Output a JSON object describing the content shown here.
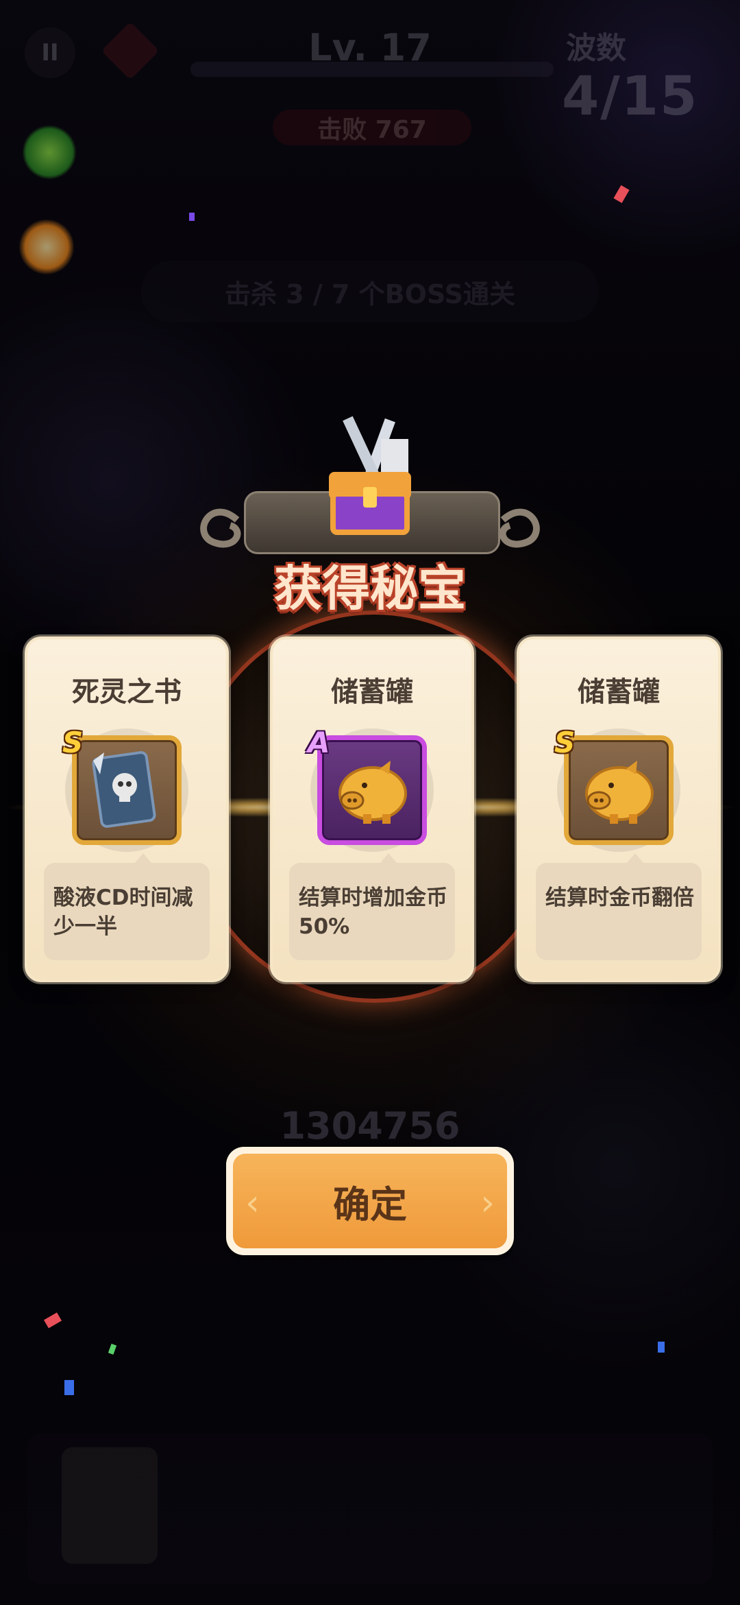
{
  "hud": {
    "pause_label": "II",
    "level": "Lv. 17",
    "wave_label": "波数",
    "wave_value": "4/15",
    "defeat_text": "击败 767",
    "objective_text": "击杀 3 / 7 个BOSS通关",
    "score": "1304756"
  },
  "reward": {
    "title": "获得秘宝",
    "cards": [
      {
        "name": "死灵之书",
        "rank": "S",
        "icon": "necronomicon-icon",
        "description": "酸液CD时间减少一半"
      },
      {
        "name": "储蓄罐",
        "rank": "A",
        "icon": "piggy-bank-icon",
        "description": "结算时增加金币50%"
      },
      {
        "name": "储蓄罐",
        "rank": "S",
        "icon": "piggy-bank-icon",
        "description": "结算时金币翻倍"
      }
    ],
    "confirm_label": "确定"
  },
  "colors": {
    "rank_s": "#ffcf3a",
    "rank_a": "#e8a0ff",
    "button": "#ef9a3a",
    "title_outline": "#b8432a"
  }
}
